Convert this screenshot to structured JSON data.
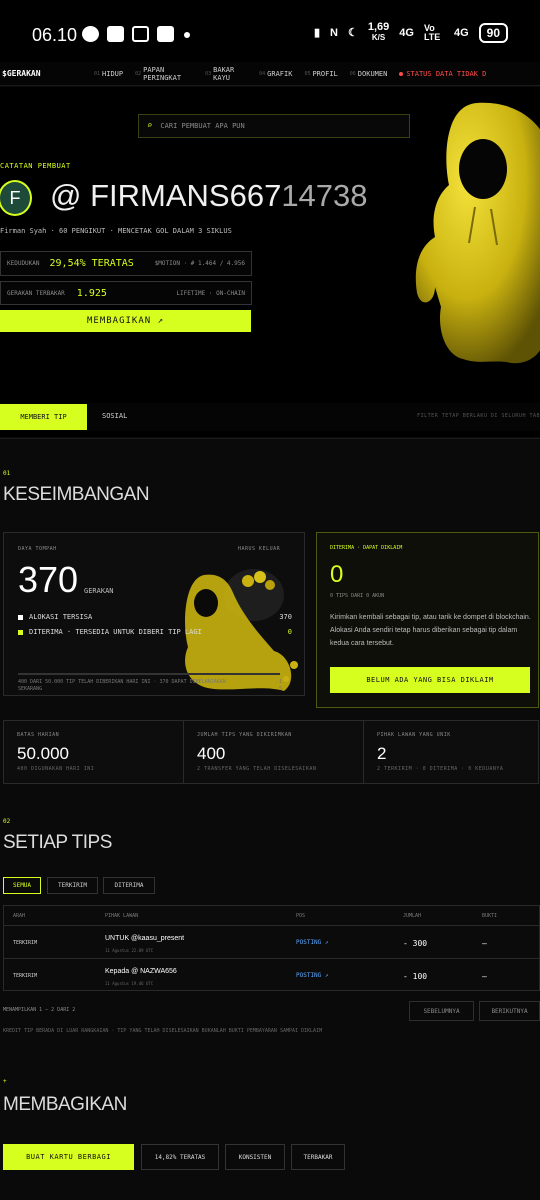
{
  "status_bar": {
    "time": "06.10",
    "speed": "1,69",
    "speed_unit": "K/S",
    "net1": "4G",
    "volte": "Vo LTE",
    "net2": "4G",
    "battery": "90"
  },
  "nav": {
    "brand": "$GERAKAN",
    "items": [
      {
        "num": "01",
        "label": "HIDUP"
      },
      {
        "num": "02",
        "label": "PAPAN PERINGKAT"
      },
      {
        "num": "03",
        "label": "BAKAR KAYU"
      },
      {
        "num": "04",
        "label": "GRAFIK"
      },
      {
        "num": "05",
        "label": "PROFIL"
      },
      {
        "num": "06",
        "label": "DOKUMEN"
      }
    ],
    "status": "STATUS DATA TIDAK D"
  },
  "hero": {
    "search_placeholder": "CARI PEMBUAT APA PUN",
    "label": "CATATAN PEMBUAT",
    "avatar_letter": "F",
    "handle_main": "@ FIRMANS667",
    "handle_fade": "14738",
    "sub": "Firman Syah · 60 PENGIKUT · MENCETAK GOL DALAM 3 SIKLUS",
    "rank_label": "KEDUDUKAN",
    "rank_value": "29,54% TERATAS",
    "rank_right": "$MOTION · # 1.464 / 4.956",
    "burn_label": "GERAKAN TERBAKAR",
    "burn_value": "1.925",
    "burn_right": "LIFETIME · ON-CHAIN",
    "share_button": "MEMBAGIKAN ↗"
  },
  "tabs": {
    "active": "MEMBERI TIP",
    "other": "SOSIAL",
    "note": "FILTER TETAP BERLAKU DI SELURUH TAB"
  },
  "balance": {
    "num": "01",
    "title": "KESEIMBANGAN",
    "power_label": "DAYA TOMPAH",
    "power_right": "HARUS KELUAR",
    "value": "370",
    "unit": "GERAKAN",
    "legend": [
      {
        "label": "ALOKASI TERSISA",
        "value": "370",
        "color": "#ffffff"
      },
      {
        "label": "DITERIMA · TERSEDIA UNTUK DIBERI TIP LAGI",
        "value": "0",
        "color": "#d6ff1f"
      }
    ],
    "progress": 0.0,
    "footnote": "400 DARI 50.000 TIP TELAH DIBERIKAN HARI INI · 370 DAPAT DIBELANJAKAN SEKARANG",
    "footnote_right": "1 5",
    "received_label": "DITERIMA · DAPAT DIKLAIM",
    "received_value": "0",
    "received_sub": "0 TIPS DARI 0 AKUN",
    "received_text": "Kirimkan kembali sebagai tip, atau tarik ke dompet di blockchain. Alokasi Anda sendiri tetap harus diberikan sebagai tip dalam kedua cara tersebut.",
    "claim_button": "BELUM ADA YANG BISA DIKLAIM"
  },
  "stats": [
    {
      "label": "BATAS HARIAN",
      "value": "50.000",
      "sub": "400 DIGUNAKAN HARI INI"
    },
    {
      "label": "JUMLAH TIPS YANG DIKIRIMKAN",
      "value": "400",
      "sub": "2 TRANSFER YANG TELAH DISELESAIKAN"
    },
    {
      "label": "PIHAK LAWAN YANG UNIK",
      "value": "2",
      "sub": "2 TERKIRIM · 0 DITERIMA · 0 KEDUANYA"
    }
  ],
  "tips": {
    "num": "02",
    "title": "SETIAP TIPS",
    "filters": [
      "SEMUA",
      "TERKIRIM",
      "DITERIMA"
    ],
    "headers": [
      "ARAH",
      "PIHAK LAWAN",
      "POS",
      "JUMLAH",
      "BUKTI"
    ],
    "rows": [
      {
        "dir": "TERKIRIM",
        "who": "UNTUK @kaasu_present",
        "date": "11 Agustus 22.09 UTC",
        "post": "POSTING ↗",
        "amount": "- 300",
        "proof": "—"
      },
      {
        "dir": "TERKIRIM",
        "who": "Kepada @ NAZWA656",
        "date": "11 Agustus 19.46 UTC",
        "post": "POSTING ↗",
        "amount": "- 100",
        "proof": "—"
      }
    ],
    "showing": "MENAMPILKAN 1 – 2 DARI 2",
    "prev": "SEBELUMNYA",
    "next": "BERIKUTNYA",
    "note": "KREDIT TIP BERADA DI LUAR RANGKAIAN · TIP YANG TELAH DISELESAIKAN BUKANLAH BUKTI PEMBAYARAN SAMPAI DIKLAIM"
  },
  "share": {
    "num": "+",
    "title": "MEMBAGIKAN",
    "chips": [
      "BUAT KARTU BERBAGI",
      "14,82% TERATAS",
      "KONSISTEN",
      "TERBAKAR"
    ]
  }
}
